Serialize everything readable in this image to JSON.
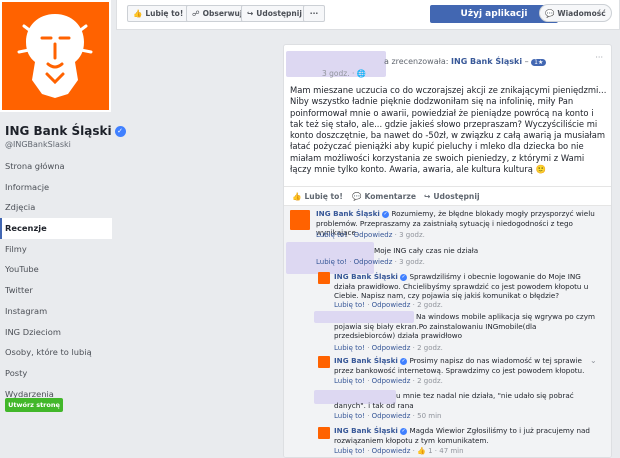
{
  "page": {
    "name": "ING Bank Śląski",
    "handle": "@INGBankSlaski",
    "nav": [
      "Strona główna",
      "Informacje",
      "Zdjęcia",
      "Recenzje",
      "Filmy",
      "YouTube",
      "Twitter",
      "Instagram",
      "ING Dzieciom",
      "Osoby, które to lubią",
      "Posty",
      "Wydarzenia"
    ],
    "active_nav": "Recenzje",
    "create_button": "Utwórz stronę"
  },
  "topbar": {
    "like": "Lubię to!",
    "follow": "Obserwuj",
    "share": "Udostępnij",
    "more": "···",
    "use_app": "Użyj aplikacji",
    "message": "Wiadomość"
  },
  "post": {
    "reviewed_text": "a zrecenzowała:",
    "reviewed_page": "ING Bank Śląski",
    "rating": "1★",
    "time": "3 godz. ·",
    "menu": "···",
    "text": "Mam mieszane uczucia co do wczorajszej akcji ze znikającymi pieniędzmi... Niby wszystko ładnie pięknie dodzwoniłam się na infolinię, miły Pan poinformował mnie o awarii, powiedział że pieniądze powrócą na konto i tak też się stało, ale... gdzie jakieś słowo przepraszam? Wyczyściliście mi konto doszczętnie, ba nawet do -50zł, w związku z całą awarią ja musiałam łatać pożyczać pieniążki aby kupić pieluchy i mleko dla dziecka bo nie miałam możliwości korzystania ze swoich pieniedzy, z którymi z Wami łączy mnie tylko konto. Awaria, awaria, ale kultura kulturą 🙂",
    "actions": {
      "like": "Lubię to!",
      "comment": "Komentarze",
      "share": "Udostępnij"
    }
  },
  "comments": [
    {
      "author": "ING Bank Śląski",
      "text": "Rozumiemy, że błędne blokady mogły przysporzyć wielu problemów. Przepraszamy za zaistniałą sytuację i niedogodności z tego wynikające.",
      "like": "Lubię to!",
      "reply": "Odpowiedz",
      "time": "3 godz."
    },
    {
      "author": "",
      "text": "Moje ING cały czas nie działa",
      "like": "Lubię to!",
      "reply": "Odpowiedz",
      "time": "3 godz."
    },
    {
      "author": "ING Bank Śląski",
      "text": "Sprawdziliśmy i obecnie logowanie do Moje ING działa prawidłowo. Chcielibyśmy sprawdzić co jest powodem kłopotu u Ciebie. Napisz nam, czy pojawia się jakiś komunikat o błędzie?",
      "like": "Lubię to!",
      "reply": "Odpowiedz",
      "time": "2 godz."
    },
    {
      "author": "",
      "text": "Na windows mobile aplikacja się wgrywa po czym pojawia się biały ekran.Po zainstalowaniu INGmobile(dla przedsiebiorców) działa prawidłowo",
      "like": "Lubię to!",
      "reply": "Odpowiedz",
      "time": "2 godz."
    },
    {
      "author": "ING Bank Śląski",
      "text": "Prosimy napisz do nas wiadomość w tej sprawie przez bankowość internetową. Sprawdzimy co jest powodem kłopotu.",
      "like": "Lubię to!",
      "reply": "Odpowiedz",
      "time": "2 godz."
    },
    {
      "author": "",
      "text": "u mnie tez nadal nie działa, \"nie udało się pobrać danych\". i tak od rana",
      "like": "Lubię to!",
      "reply": "Odpowiedz",
      "time": "50 min"
    },
    {
      "author": "ING Bank Śląski",
      "text": "Magda Wiewior Zgłosiliśmy to i już pracujemy nad rozwiązaniem kłopotu z tym komunikatem.",
      "like": "Lubię to!",
      "reply": "Odpowiedz",
      "reactions": "1",
      "time": "47 min"
    }
  ],
  "colors": {
    "ing_orange": "#ff6200",
    "fb_blue": "#4267b2",
    "link": "#385898",
    "create_green": "#42b72a"
  }
}
